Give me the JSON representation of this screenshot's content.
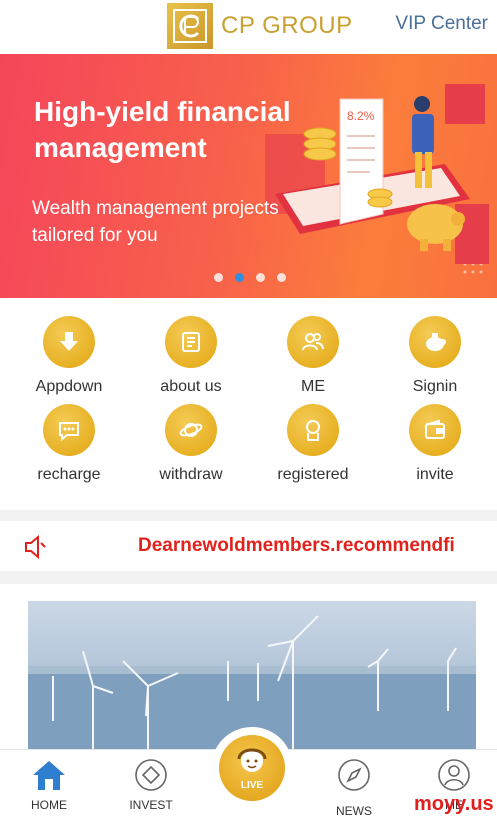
{
  "header": {
    "logo_text": "CP GROUP",
    "vip_link": "VIP Center"
  },
  "banner": {
    "title": "High-yield financial management",
    "subtitle": "Wealth management projects tailored for you",
    "receipt_rate": "8.2%",
    "slide_count": 4,
    "active_slide": 2
  },
  "grid": {
    "items": [
      {
        "label": "Appdown",
        "icon": "download-icon"
      },
      {
        "label": "about us",
        "icon": "scroll-icon"
      },
      {
        "label": "ME",
        "icon": "users-icon"
      },
      {
        "label": "Signin",
        "icon": "piggy-bank-icon"
      },
      {
        "label": "recharge",
        "icon": "chat-icon"
      },
      {
        "label": "withdraw",
        "icon": "planet-icon"
      },
      {
        "label": "registered",
        "icon": "person-badge-icon"
      },
      {
        "label": "invite",
        "icon": "wallet-icon"
      }
    ]
  },
  "notice": {
    "text": "Dearnewoldmembers.recommendfi"
  },
  "tabbar": {
    "home": "HOME",
    "invest": "INVEST",
    "live": "LIVE",
    "news": "NEWS",
    "me": "ME"
  },
  "watermark": "moyy.us",
  "colors": {
    "gold": "#e2a50f",
    "banner_red": "#f5455b",
    "notice_red": "#e1221c",
    "vip_blue": "#4a6f9a",
    "active_tab": "#2f7fd0"
  }
}
